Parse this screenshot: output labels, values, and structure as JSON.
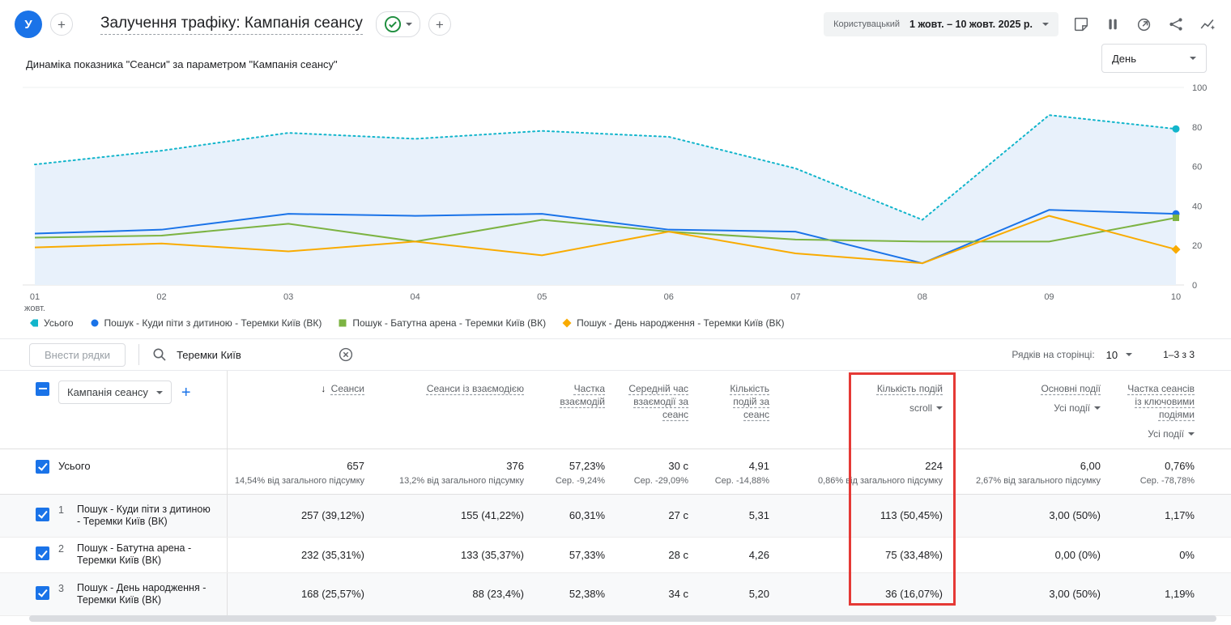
{
  "header": {
    "avatar_letter": "У",
    "title": "Залучення трафіку: Кампанія сеансу",
    "date_label": "Користувацький",
    "date_range": "1 жовт. – 10 жовт. 2025 р."
  },
  "chart": {
    "title": "Динаміка показника \"Сеанси\" за параметром \"Кампанія сеансу\"",
    "granularity": "День"
  },
  "chart_data": {
    "type": "line",
    "x": [
      "01",
      "02",
      "03",
      "04",
      "05",
      "06",
      "07",
      "08",
      "09",
      "10"
    ],
    "x_unit": "жовт.",
    "ylim": [
      0,
      100
    ],
    "yticks": [
      0,
      20,
      40,
      60,
      80,
      100
    ],
    "fill_color": "#e8f1fb",
    "legend_position": "bottom",
    "series": [
      {
        "name": "Усього",
        "color": "#12b5cb",
        "style": "dotted",
        "fill": true,
        "marker": "circle",
        "legend_marker": "tag",
        "values": [
          61,
          68,
          77,
          74,
          78,
          75,
          59,
          33,
          86,
          79
        ]
      },
      {
        "name": "Пошук - Куди піти з дитиною - Теремки Київ (ВК)",
        "color": "#1a73e8",
        "style": "solid",
        "fill": false,
        "marker": "circle",
        "legend_marker": "circle",
        "values": [
          26,
          28,
          36,
          35,
          36,
          28,
          27,
          11,
          38,
          36
        ]
      },
      {
        "name": "Пошук - Батутна арена - Теремки Київ (ВК)",
        "color": "#7cb342",
        "style": "solid",
        "fill": false,
        "marker": "square",
        "legend_marker": "square",
        "values": [
          24,
          25,
          31,
          22,
          33,
          27,
          23,
          22,
          22,
          34
        ]
      },
      {
        "name": "Пошук - День народження - Теремки Київ (ВК)",
        "color": "#f9ab00",
        "style": "solid",
        "fill": false,
        "marker": "diamond",
        "legend_marker": "diamond",
        "values": [
          19,
          21,
          17,
          22,
          15,
          27,
          16,
          11,
          35,
          18
        ]
      }
    ]
  },
  "icons": {
    "sort_desc": "↓"
  },
  "toolbar": {
    "edit_rows": "Внести рядки",
    "search_value": "Теремки Київ",
    "rows_per_page_label": "Рядків на сторінці:",
    "rows_per_page_value": "10",
    "page_info": "1–3 з 3"
  },
  "table": {
    "dimension_selector": "Кампанія сеансу",
    "add_dimension": "+",
    "columns": {
      "sessions": "Сеанси",
      "engaged_sessions": "Сеанси із взаємодією",
      "engagement_rate": "Частка взаємодій",
      "avg_engagement_time": "Середній час взаємодії за сеанс",
      "events_per_session": "Кількість подій за сеанс",
      "event_count": "Кількість подій",
      "event_count_filter": "scroll",
      "key_events": "Основні події",
      "key_events_filter": "Усі події",
      "session_key_event_rate": "Частка сеансів із ключовими подіями",
      "session_key_event_rate_filter": "Усі події"
    },
    "totals": {
      "label": "Усього",
      "sessions": "657",
      "sessions_sub": "14,54% від загального підсумку",
      "engaged_sessions": "376",
      "engaged_sessions_sub": "13,2% від загального підсумку",
      "engagement_rate": "57,23%",
      "engagement_rate_sub": "Сер. -9,24%",
      "avg_time": "30 с",
      "avg_time_sub": "Сер. -29,09%",
      "events_per_session": "4,91",
      "events_per_session_sub": "Сер. -14,88%",
      "event_count": "224",
      "event_count_sub": "0,86% від загального підсумку",
      "key_events": "6,00",
      "key_events_sub": "2,67% від загального підсумку",
      "key_event_rate": "0,76%",
      "key_event_rate_sub": "Сер. -78,78%"
    },
    "rows": [
      {
        "index": "1",
        "name": "Пошук - Куди піти з дитиною - Теремки Київ (ВК)",
        "sessions": "257 (39,12%)",
        "engaged_sessions": "155 (41,22%)",
        "engagement_rate": "60,31%",
        "avg_time": "27 с",
        "events_per_session": "5,31",
        "event_count": "113 (50,45%)",
        "key_events": "3,00 (50%)",
        "key_event_rate": "1,17%"
      },
      {
        "index": "2",
        "name": "Пошук - Батутна арена - Теремки Київ (ВК)",
        "sessions": "232 (35,31%)",
        "engaged_sessions": "133 (35,37%)",
        "engagement_rate": "57,33%",
        "avg_time": "28 с",
        "events_per_session": "4,26",
        "event_count": "75 (33,48%)",
        "key_events": "0,00 (0%)",
        "key_event_rate": "0%"
      },
      {
        "index": "3",
        "name": "Пошук - День народження - Теремки Київ (ВК)",
        "sessions": "168 (25,57%)",
        "engaged_sessions": "88 (23,4%)",
        "engagement_rate": "52,38%",
        "avg_time": "34 с",
        "events_per_session": "5,20",
        "event_count": "36 (16,07%)",
        "key_events": "3,00 (50%)",
        "key_event_rate": "1,19%"
      }
    ]
  }
}
